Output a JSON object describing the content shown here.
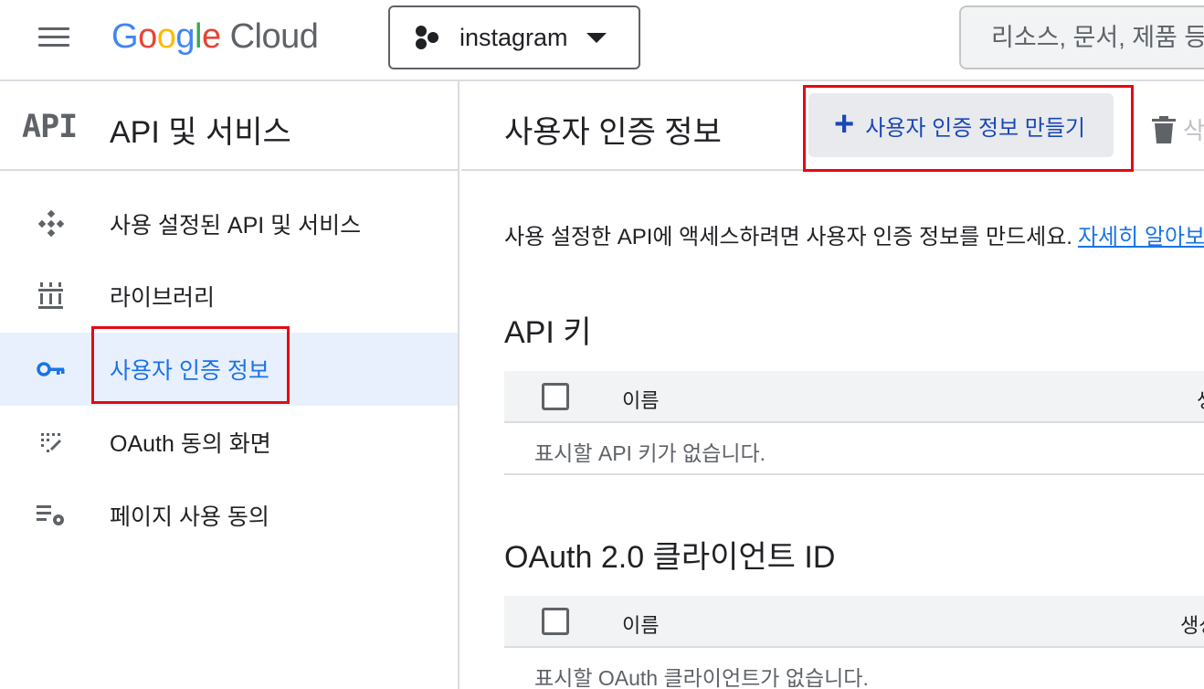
{
  "colors": {
    "accent": "#1a73e8",
    "highlight": "#e50914",
    "active_bg": "#e8f0fe",
    "text": "#202124",
    "muted": "#5f6368"
  },
  "topbar": {
    "menu_icon": "hamburger-icon",
    "logo": {
      "google": "Google",
      "cloud": "Cloud"
    },
    "project": {
      "icon": "project-hexagons-icon",
      "name": "instagram"
    },
    "search": {
      "placeholder": "리소스, 문서, 제품 등"
    }
  },
  "sidebar": {
    "logo_text": "API",
    "title": "API 및 서비스",
    "items": [
      {
        "icon": "enabled-apis-icon",
        "label": "사용 설정된 API 및 서비스",
        "active": false
      },
      {
        "icon": "library-icon",
        "label": "라이브러리",
        "active": false
      },
      {
        "icon": "key-icon",
        "label": "사용자 인증 정보",
        "active": true
      },
      {
        "icon": "oauth-consent-icon",
        "label": "OAuth 동의 화면",
        "active": false
      },
      {
        "icon": "page-usage-icon",
        "label": "페이지 사용 동의",
        "active": false
      }
    ]
  },
  "main": {
    "title": "사용자 인증 정보",
    "create_button": {
      "icon": "plus-icon",
      "label": "사용자 인증 정보 만들기"
    },
    "delete_button": {
      "icon": "trash-icon",
      "label": "삭제"
    },
    "intro": {
      "text": "사용 설정한 API에 액세스하려면 사용자 인증 정보를 만드세요.",
      "link": "자세히 알아보기"
    },
    "api_keys": {
      "title": "API 키",
      "columns": [
        "이름",
        "생성일"
      ],
      "empty": "표시할 API 키가 없습니다."
    },
    "oauth_clients": {
      "title": "OAuth 2.0 클라이언트 ID",
      "columns": [
        "이름",
        "생성일"
      ],
      "empty": "표시할 OAuth 클라이언트가 없습니다."
    }
  }
}
